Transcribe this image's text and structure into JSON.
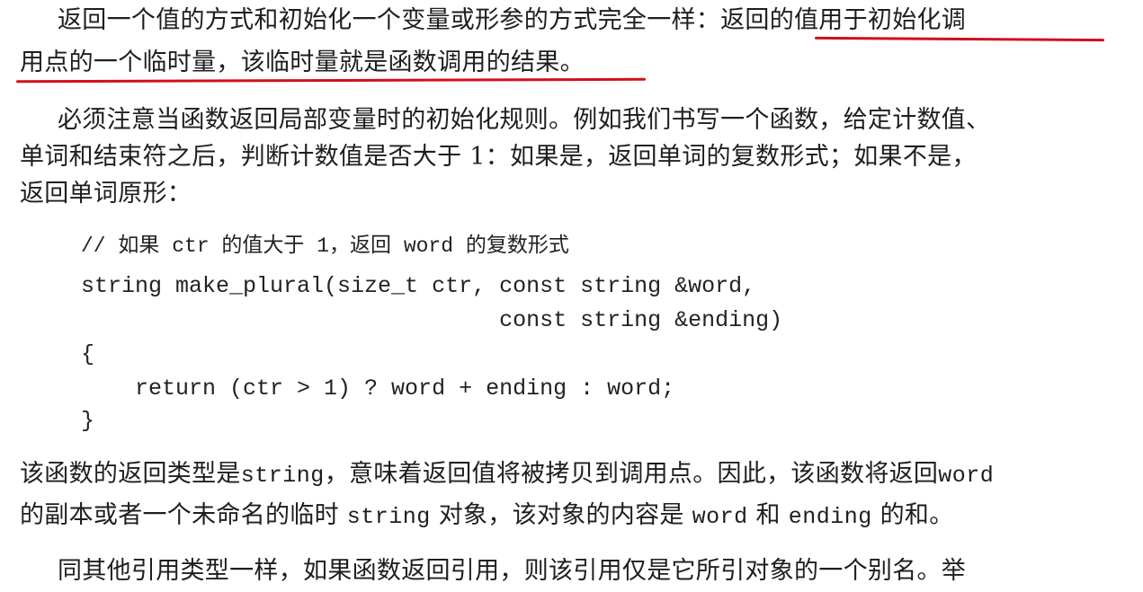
{
  "para1": {
    "line1_a": "返回一个值的方式和初始化一个变量或形参的方式完全一样：",
    "line1_b": "返回的值用于初始化调",
    "line2": "用点的一个临时量，该临时量就是函数调用的结果。"
  },
  "para2": {
    "line1": "必须注意当函数返回局部变量时的初始化规则。例如我们书写一个函数，给定计数值、",
    "line2": "单词和结束符之后，判断计数值是否大于 1：如果是，返回单词的复数形式；如果不是，",
    "line3": "返回单词原形："
  },
  "code": {
    "comment": "// 如果 ctr 的值大于 1，返回 word 的复数形式",
    "line1": "string make_plural(size_t ctr, const string &word,",
    "line2": "                               const string &ending)",
    "line3": "{",
    "line4": "    return (ctr > 1) ? word + ending : word;",
    "line5": "}"
  },
  "para3": {
    "l1_a": "该函数的返回类型是",
    "l1_code1": "string",
    "l1_b": "，意味着返回值将被拷贝到调用点。因此，该函数将返回",
    "l1_code2": "word",
    "l2_a": "的副本或者一个未命名的临时",
    "l2_code1": "string",
    "l2_b": "对象，该对象的内容是",
    "l2_code2": "word",
    "l2_c": "和",
    "l2_code3": "ending",
    "l2_d": "的和。"
  },
  "para4": {
    "line1": "同其他引用类型一样，如果函数返回引用，则该引用仅是它所引对象的一个别名。举"
  },
  "colors": {
    "highlight_underline": "#d10f1c",
    "text": "#1e1e1e"
  }
}
